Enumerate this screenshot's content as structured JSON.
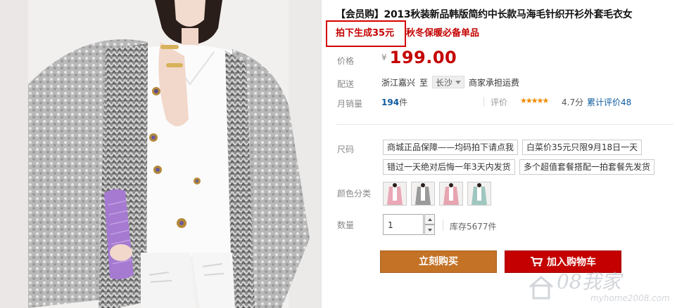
{
  "product": {
    "title_prefix": "【会员购】",
    "title_text": "2013秋装新品韩版简约中长款马海毛针织开衫外套毛衣女",
    "promo_boxed": "拍下生成35元",
    "promo_rest": "秋冬保暖必备单品"
  },
  "price": {
    "label": "价格",
    "currency": "¥",
    "value": "199.00"
  },
  "shipping": {
    "label": "配送",
    "from": "浙江嘉兴",
    "to_word": "至",
    "city": "长沙",
    "note": "商家承担运费"
  },
  "sales": {
    "label": "月销量",
    "count": "194",
    "unit": "件",
    "rating_label": "评价",
    "stars": "★★★★★",
    "score": "4.7分",
    "reviews": "累计评价48"
  },
  "sizes": {
    "label": "尺码",
    "options": [
      "商城正品保障——均码拍下请点我",
      "白菜价35元只限9月18日一天",
      "错过一天绝对后悔一年3天内发货",
      "多个超值套餐搭配一拍套餐先发货"
    ]
  },
  "colors": {
    "label": "颜色分类",
    "swatch_colors": [
      "#e9a8b6",
      "#9a9a9a",
      "#e6a5b0",
      "#9fc7c0"
    ]
  },
  "quantity": {
    "label": "数量",
    "value": "1",
    "stock": "库存5677件"
  },
  "actions": {
    "buy_now": "立刻购买",
    "add_cart": "加入购物车"
  },
  "watermark": {
    "brand": "08我家",
    "url": "myhome2008.com"
  },
  "colors_theme": {
    "price_red": "#c40000",
    "buy_orange": "#c47226",
    "cart_red": "#c40000",
    "link_blue": "#0c5a9e"
  }
}
